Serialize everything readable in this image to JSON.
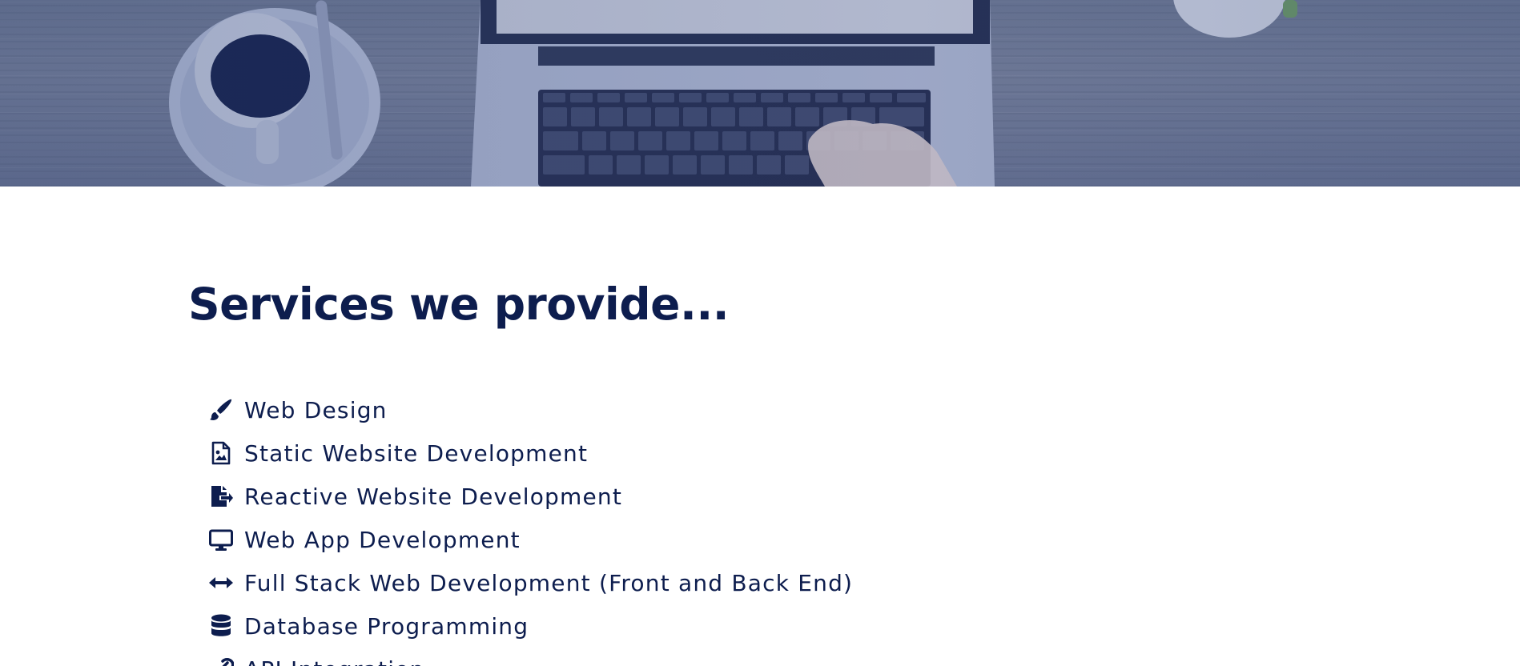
{
  "hero": {
    "image_alt": "laptop-on-desk-with-coffee"
  },
  "services": {
    "title": "Services we provide...",
    "items": [
      {
        "label": "Web Design",
        "icon": "paint-brush-icon"
      },
      {
        "label": "Static Website Development",
        "icon": "file-image-icon"
      },
      {
        "label": "Reactive Website Development",
        "icon": "file-export-icon"
      },
      {
        "label": "Web App Development",
        "icon": "desktop-icon"
      },
      {
        "label": "Full Stack Web Development (Front and Back End)",
        "icon": "arrows-horizontal-icon"
      },
      {
        "label": "Database Programming",
        "icon": "database-icon"
      },
      {
        "label": "API Integration",
        "icon": "link-icon"
      }
    ]
  },
  "colors": {
    "primary": "#0d1d4e",
    "background": "#ffffff"
  }
}
